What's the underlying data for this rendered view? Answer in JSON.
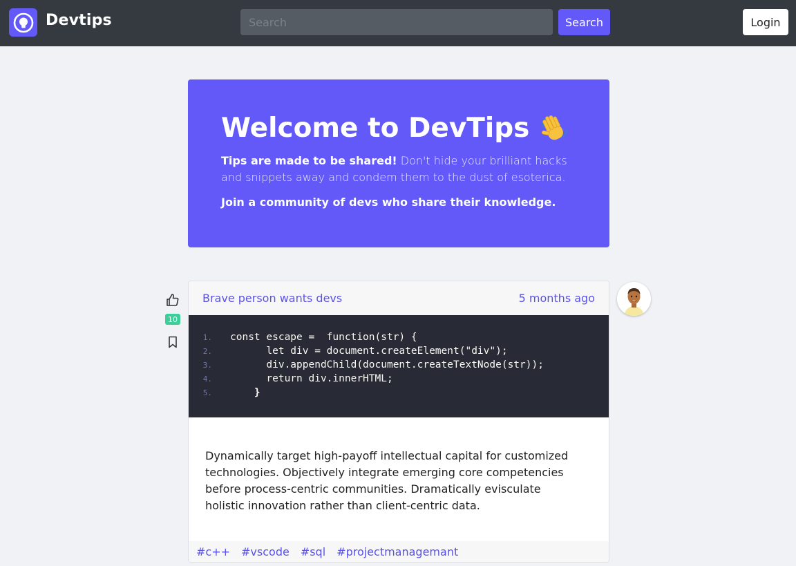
{
  "navbar": {
    "brand": "Devtips",
    "search_placeholder": "Search",
    "search_button": "Search",
    "login_button": "Login",
    "brand_color": "#6259f8"
  },
  "hero": {
    "title": "Welcome to DevTips",
    "title_emoji": "waving-hand-icon",
    "intro_bold": "Tips are made to be shared!",
    "intro_rest": " Don't hide your brilliant hacks and snippets away and condem them to the dust of esoterica.",
    "join": "Join a community of devs who share their knowledge."
  },
  "post": {
    "title": "Brave person wants devs",
    "time": "5 months ago",
    "votes": "10",
    "code": [
      {
        "num": "1.",
        "text": "const escape =  function(str) {"
      },
      {
        "num": "2.",
        "text": "      let div = document.createElement(\"div\");"
      },
      {
        "num": "3.",
        "text": "      div.appendChild(document.createTextNode(str));"
      },
      {
        "num": "4.",
        "text": "      return div.innerHTML;"
      },
      {
        "num": "5.",
        "text": "    }"
      }
    ],
    "body": "Dynamically target high-payoff intellectual capital for customized technologies. Objectively integrate emerging core competencies before process-centric communities. Dramatically evisculate holistic innovation rather than client-centric data.",
    "tags": [
      "#c++",
      "#vscode",
      "#sql",
      "#projectmanagemant"
    ]
  }
}
